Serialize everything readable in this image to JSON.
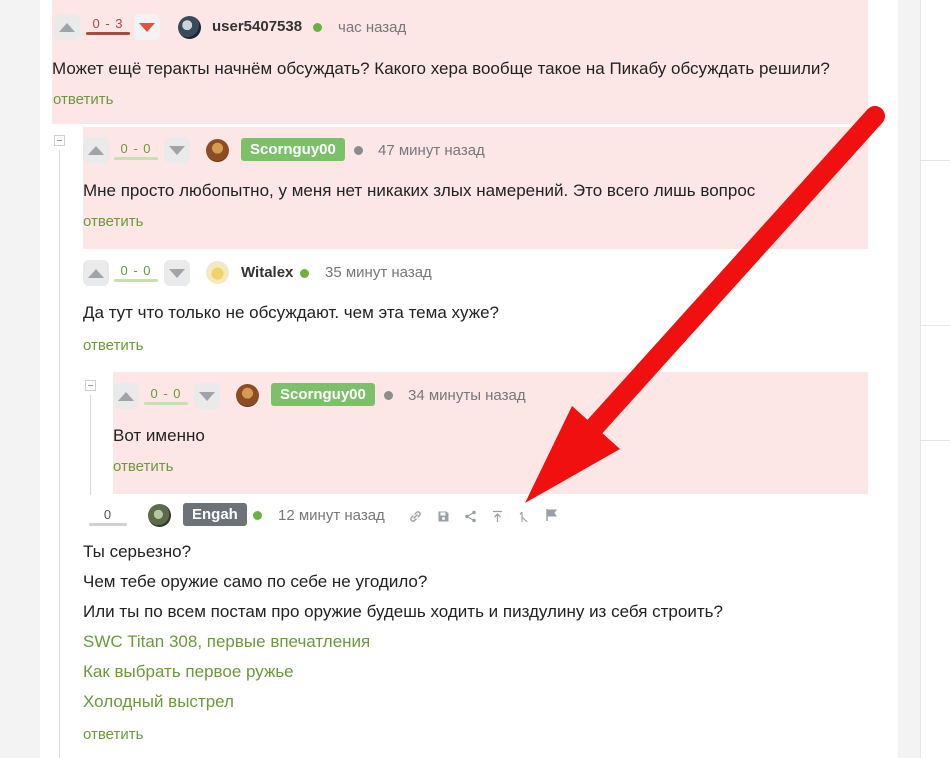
{
  "colors": {
    "pink_bg": "#fde7e6",
    "green_link": "#6a9a3b",
    "online_dot": "#6bb244",
    "offline_dot": "#8c8c8c",
    "badge_green": "#7cc06a",
    "badge_gray": "#6d7278",
    "arrow_red": "#f01010",
    "rating_red_bar": "#a64a42",
    "rating_green_bar": "#c8dfb2"
  },
  "comments": [
    {
      "rating": "0 - 3",
      "user": "user5407538",
      "time": "час назад",
      "text": "Может ещё теракты начнём обсуждать? Какого хера вообще такое на Пикабу обсуждать решили?",
      "reply": "ответить"
    },
    {
      "rating": "0 - 0",
      "user": "Scornguy00",
      "time": "47 минут назад",
      "text": "Мне просто любопытно, у меня нет никаких злых намерений. Это всего лишь вопрос",
      "reply": "ответить"
    },
    {
      "rating": "0 - 0",
      "user": "Witalex",
      "time": "35 минут назад",
      "text": "Да тут что только не обсуждают. чем эта тема хуже?",
      "reply": "ответить"
    },
    {
      "rating": "0 - 0",
      "user": "Scornguy00",
      "time": "34 минуты назад",
      "text": "Вот именно",
      "reply": "ответить"
    },
    {
      "rating": "0",
      "user": "Engah",
      "time": "12 минут назад",
      "lines": [
        "Ты серьезно?",
        "Чем тебе оружие само по себе не угодило?",
        "Или ты по всем постам про оружие будешь ходить и пиздулину из себя строить?"
      ],
      "links": [
        "SWC Titan 308, первые впечатления",
        "Как выбрать первое ружье",
        "Холодный выстрел"
      ],
      "reply": "ответить"
    }
  ]
}
